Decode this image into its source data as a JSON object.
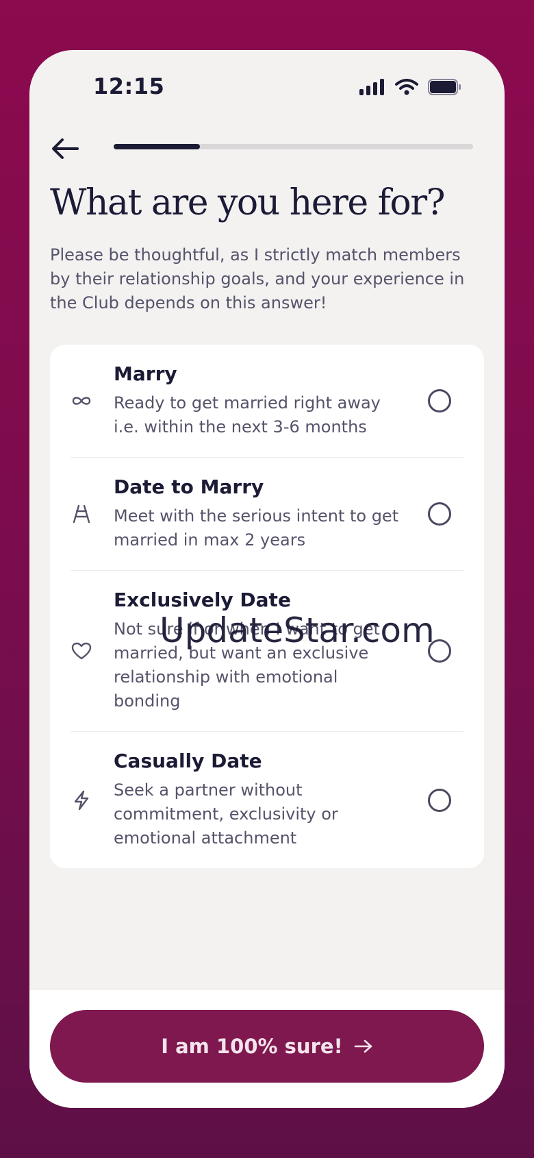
{
  "status_bar": {
    "time": "12:15",
    "icons": [
      "signal-icon",
      "wifi-icon",
      "battery-icon"
    ]
  },
  "nav": {
    "back_icon": "arrow-left-icon",
    "progress": 0.24
  },
  "header": {
    "title": "What are you here for?",
    "subtitle": "Please be thoughtful, as I strictly match members by their relationship goals, and your experience in the Club depends on this answer!"
  },
  "options": [
    {
      "icon": "infinity-icon",
      "title": "Marry",
      "description": "Ready to get married right away i.e. within the next 3-6 months",
      "selected": false
    },
    {
      "icon": "ladder-icon",
      "title": "Date to Marry",
      "description": "Meet with the serious intent to get married in max 2 years",
      "selected": false
    },
    {
      "icon": "heart-icon",
      "title": "Exclusively Date",
      "description": "Not sure if or when I want to get married, but want an exclusive relationship with emotional bonding",
      "selected": false
    },
    {
      "icon": "lightning-icon",
      "title": "Casually Date",
      "description": "Seek a partner without commitment, exclusivity or emotional attachment",
      "selected": false
    }
  ],
  "watermark": "UpdateStar.com",
  "footer": {
    "cta_label": "I am 100% sure!",
    "cta_icon": "arrow-right-icon"
  },
  "colors": {
    "background": "#8c0a4e",
    "accent": "#7e184e",
    "text_primary": "#1c1b36",
    "text_secondary": "#55536a"
  }
}
